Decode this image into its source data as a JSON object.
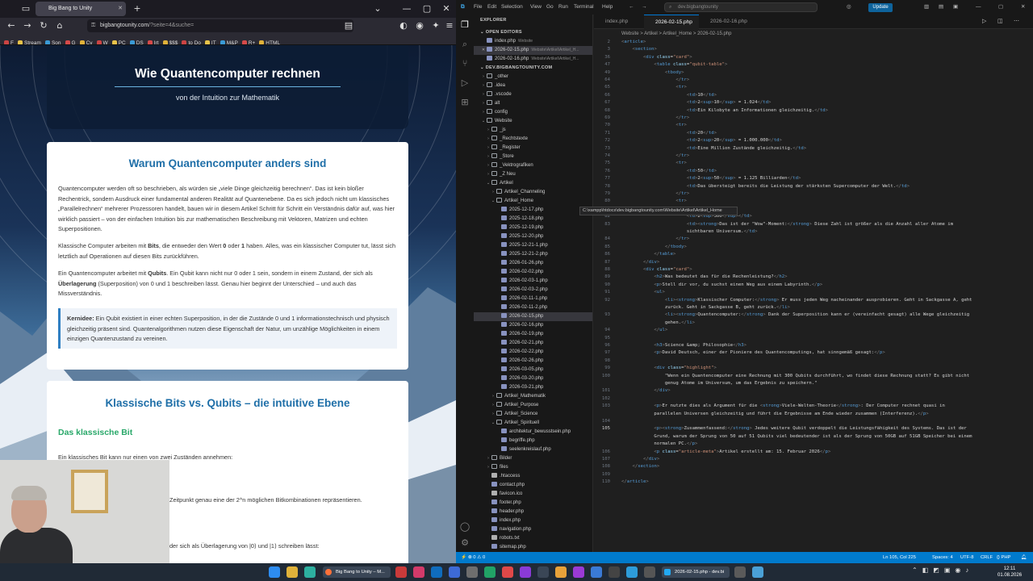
{
  "browser": {
    "tab_title": "Big Bang to Unity",
    "url_domain": "bigbangtounity.com",
    "url_path": "/?seite=4&suche=",
    "bookmarks": [
      "F",
      "Stream",
      "Son",
      "G",
      "Cy",
      "W",
      "PC",
      "DS",
      "Irt",
      "$$$",
      "to Do",
      "IT",
      "M&P",
      "R+",
      "HTML"
    ],
    "page": {
      "hero_title": "Wie Quantencomputer rechnen",
      "hero_subtitle": "von der Intuition zur Mathematik",
      "card1": {
        "heading": "Warum Quantencomputer anders sind",
        "p1": "Quantencomputer werden oft so beschrieben, als würden sie „viele Dinge gleichzeitig berechnen“. Das ist kein bloßer Rechentrick, sondern Ausdruck einer fundamental anderen Realität auf Quantenebene. Da es sich jedoch nicht um klassisches „Parallelrechnen“ mehrerer Prozessoren handelt, bauen wir in diesem Artikel Schritt für Schritt ein Verständnis dafür auf, was hier wirklich passiert – von der einfachen Intuition bis zur mathematischen Beschreibung mit Vektoren, Matrizen und echten Superpositionen.",
        "p2_a": "Klassische Computer arbeiten mit ",
        "p2_b": "Bits",
        "p2_c": ", die entweder den Wert ",
        "p2_d": "0",
        "p2_e": " oder ",
        "p2_f": "1",
        "p2_g": " haben. Alles, was ein klassischer Computer tut, lässt sich letztlich auf Operationen auf diesen Bits zurückführen.",
        "p3_a": "Ein Quantencomputer arbeitet mit ",
        "p3_b": "Qubits",
        "p3_c": ". Ein Qubit kann nicht nur 0 oder 1 sein, sondern in einem Zustand, der sich als ",
        "p3_d": "Überlagerung",
        "p3_e": " (Superposition) von 0 und 1 beschreiben lässt. Genau hier beginnt der Unterschied – und auch das Missverständnis.",
        "kern_label": "Kernidee:",
        "kern_text": " Ein Qubit existiert in einer echten Superposition, in der die Zustände 0 und 1 informationstechnisch und physisch gleichzeitig präsent sind. Quantenalgorithmen nutzen diese Eigenschaft der Natur, um unzählige Möglichkeiten in einem einzigen Quantenzustand zu vereinen."
      },
      "card2": {
        "heading": "Klassische Bits vs. Qubits – die intuitive Ebene",
        "subheading": "Das klassische Bit",
        "p1": "Ein klassisches Bit kann nur einen von zwei Zuständen annehmen:",
        "p2_partial": "Zeitpunkt genau eine der 2^n möglichen Bitkombinationen repräsentieren.",
        "p3_partial": "der sich als Überlagerung von |0⟩ und |1⟩ schreiben lässt:"
      }
    }
  },
  "vscode": {
    "menu": [
      "File",
      "Edit",
      "Selection",
      "View",
      "Go",
      "Run",
      "Terminal",
      "Help"
    ],
    "search": "dev.bigbangtounity",
    "update_label": "Update",
    "explorer_title": "EXPLORER",
    "open_editors_title": "OPEN EDITORS",
    "open_editors": [
      {
        "name": "index.php",
        "hint": "Website"
      },
      {
        "name": "2026-02-15.php",
        "hint": "Website\\Artikel\\Artikel_H..."
      },
      {
        "name": "2026-02-16.php",
        "hint": "Website\\Artikel\\Artikel_H..."
      }
    ],
    "workspace_title": "DEV.BIGBANGTOUNITY.COM",
    "tree": [
      {
        "d": 1,
        "t": "f",
        "n": "_other"
      },
      {
        "d": 1,
        "t": "f",
        "n": ".idea"
      },
      {
        "d": 1,
        "t": "f",
        "n": ".vscode"
      },
      {
        "d": 1,
        "t": "f",
        "n": "alt"
      },
      {
        "d": 1,
        "t": "f",
        "n": "config"
      },
      {
        "d": 1,
        "t": "o",
        "n": "Website"
      },
      {
        "d": 2,
        "t": "f",
        "n": "_js"
      },
      {
        "d": 2,
        "t": "f",
        "n": "_Rechtstexte"
      },
      {
        "d": 2,
        "t": "f",
        "n": "_Register"
      },
      {
        "d": 2,
        "t": "f",
        "n": "_Store"
      },
      {
        "d": 2,
        "t": "f",
        "n": "_Vektrografiken"
      },
      {
        "d": 2,
        "t": "f",
        "n": "_Z Neu"
      },
      {
        "d": 2,
        "t": "o",
        "n": "Artikel"
      },
      {
        "d": 3,
        "t": "f",
        "n": "Artikel_Channeling"
      },
      {
        "d": 3,
        "t": "o",
        "n": "Artikel_Home"
      },
      {
        "d": 4,
        "t": "p",
        "n": "2025-12-17.php"
      },
      {
        "d": 4,
        "t": "p",
        "n": "2025-12-18.php"
      },
      {
        "d": 4,
        "t": "p",
        "n": "2025-12-19.php"
      },
      {
        "d": 4,
        "t": "p",
        "n": "2025-12-20.php"
      },
      {
        "d": 4,
        "t": "p",
        "n": "2025-12-21-1.php"
      },
      {
        "d": 4,
        "t": "p",
        "n": "2025-12-21-2.php"
      },
      {
        "d": 4,
        "t": "p",
        "n": "2026-01-26.php"
      },
      {
        "d": 4,
        "t": "p",
        "n": "2026-02-02.php"
      },
      {
        "d": 4,
        "t": "p",
        "n": "2026-02-03-1.php"
      },
      {
        "d": 4,
        "t": "p",
        "n": "2026-02-03-2.php"
      },
      {
        "d": 4,
        "t": "p",
        "n": "2026-02-11-1.php"
      },
      {
        "d": 4,
        "t": "p",
        "n": "2026-02-11-2.php"
      },
      {
        "d": 4,
        "t": "p",
        "n": "2026-02-15.php",
        "sel": true
      },
      {
        "d": 4,
        "t": "p",
        "n": "2026-02-16.php"
      },
      {
        "d": 4,
        "t": "p",
        "n": "2026-02-19.php"
      },
      {
        "d": 4,
        "t": "p",
        "n": "2026-02-21.php"
      },
      {
        "d": 4,
        "t": "p",
        "n": "2026-02-22.php"
      },
      {
        "d": 4,
        "t": "p",
        "n": "2026-02-26.php"
      },
      {
        "d": 4,
        "t": "p",
        "n": "2026-03-05.php"
      },
      {
        "d": 4,
        "t": "p",
        "n": "2026-03-20.php"
      },
      {
        "d": 4,
        "t": "p",
        "n": "2026-03-21.php"
      },
      {
        "d": 3,
        "t": "f",
        "n": "Artikel_Mathematik"
      },
      {
        "d": 3,
        "t": "f",
        "n": "Artikel_Purpose"
      },
      {
        "d": 3,
        "t": "f",
        "n": "Artikel_Science"
      },
      {
        "d": 3,
        "t": "o",
        "n": "Artikel_Spirituell"
      },
      {
        "d": 4,
        "t": "p",
        "n": "architektur_bewusstsein.php"
      },
      {
        "d": 4,
        "t": "p",
        "n": "begriffe.php"
      },
      {
        "d": 4,
        "t": "p",
        "n": "seelenkreislauf.php"
      },
      {
        "d": 2,
        "t": "f",
        "n": "Bilder"
      },
      {
        "d": 2,
        "t": "f",
        "n": "files"
      },
      {
        "d": 2,
        "t": "x",
        "n": ".htaccess"
      },
      {
        "d": 2,
        "t": "p",
        "n": "contact.php"
      },
      {
        "d": 2,
        "t": "x",
        "n": "favicon.ico"
      },
      {
        "d": 2,
        "t": "p",
        "n": "footer.php"
      },
      {
        "d": 2,
        "t": "p",
        "n": "header.php"
      },
      {
        "d": 2,
        "t": "p",
        "n": "index.php"
      },
      {
        "d": 2,
        "t": "p",
        "n": "navigation.php"
      },
      {
        "d": 2,
        "t": "x",
        "n": "robots.txt"
      },
      {
        "d": 2,
        "t": "p",
        "n": "sitemap.php"
      }
    ],
    "tooltip": "C:\\xampp\\htdocs\\dev.bigbangtounity.com\\Website\\Artikel\\Artikel_Home",
    "tabs": [
      "index.php",
      "2026-02-15.php",
      "2026-02-16.php"
    ],
    "breadcrumb": "Website  >  Artikel  >  Artikel_Home  >  2026-02-15.php",
    "code": [
      [
        "2",
        "<article>"
      ],
      [
        "3",
        "    <section>"
      ],
      [
        "36",
        "        <div class=\"card\">"
      ],
      [
        "47",
        "            <table class=\"qubit-table\">"
      ],
      [
        "49",
        "                <tbody>"
      ],
      [
        "64",
        "                    </tr>"
      ],
      [
        "65",
        "                    <tr>"
      ],
      [
        "66",
        "                        <td>10</td>"
      ],
      [
        "67",
        "                        <td>2<sup>10</sup> = 1.024</td>"
      ],
      [
        "68",
        "                        <td>Ein Kilobyte an Informationen gleichzeitig.</td>"
      ],
      [
        "69",
        "                    </tr>"
      ],
      [
        "70",
        "                    <tr>"
      ],
      [
        "71",
        "                        <td>20</td>"
      ],
      [
        "72",
        "                        <td>2<sup>20</sup> = 1.000.000</td>"
      ],
      [
        "73",
        "                        <td>Eine Million Zustände gleichzeitig.</td>"
      ],
      [
        "74",
        "                    </tr>"
      ],
      [
        "75",
        "                    <tr>"
      ],
      [
        "76",
        "                        <td>50</td>"
      ],
      [
        "77",
        "                        <td>2<sup>50</sup> = 1.125 Billiarden</td>"
      ],
      [
        "78",
        "                        <td>Das übersteigt bereits die Leistung der stärksten Supercomputer der Welt.</td>"
      ],
      [
        "79",
        "                    </tr>"
      ],
      [
        "80",
        "                    <tr>"
      ],
      [
        "81",
        ""
      ],
      [
        "82",
        "                        <td>2<sup>300</sup></td>"
      ],
      [
        "83",
        "                        <td><strong>Das ist der \"Wow\"-Moment:</strong> Diese Zahl ist größer als die Anzahl aller Atome im"
      ],
      [
        "",
        "                        sichtbaren Universum.</td>"
      ],
      [
        "84",
        "                    </tr>"
      ],
      [
        "85",
        "                </tbody>"
      ],
      [
        "86",
        "            </table>"
      ],
      [
        "87",
        "        </div>"
      ],
      [
        "88",
        "        <div class=\"card\">"
      ],
      [
        "89",
        "            <h2>Was bedeutet das für die Rechenleistung?</h2>"
      ],
      [
        "90",
        "            <p>Stell dir vor, du suchst einen Weg aus einem Labyrinth.</p>"
      ],
      [
        "91",
        "            <ul>"
      ],
      [
        "92",
        "                <li><strong>Klassischer Computer:</strong> Er muss jeden Weg nacheinander ausprobieren. Geht in Sackgasse A, geht"
      ],
      [
        "",
        "                zurück. Geht in Sackgasse B, geht zurück.</li>"
      ],
      [
        "93",
        "                <li><strong>Quantencomputer:</strong> Dank der Superposition kann er (vereinfacht gesagt) alle Wege gleichzeitig"
      ],
      [
        "",
        "                gehen.</li>"
      ],
      [
        "94",
        "            </ul>"
      ],
      [
        "95",
        ""
      ],
      [
        "96",
        "            <h3>Science &amp; Philosophie</h3>"
      ],
      [
        "97",
        "            <p>David Deutsch, einer der Pioniere des Quantencomputings, hat sinngemäß gesagt:</p>"
      ],
      [
        "98",
        ""
      ],
      [
        "99",
        "            <div class=\"highlight\">"
      ],
      [
        "100",
        "                \"Wenn ein Quantencomputer eine Rechnung mit 300 Qubits durchführt, wo findet diese Rechnung statt? Es gibt nicht"
      ],
      [
        "",
        "                genug Atome im Universum, um das Ergebnis zu speichern.\""
      ],
      [
        "101",
        "            </div>"
      ],
      [
        "102",
        ""
      ],
      [
        "103",
        "            <p>Er nutzte dies als Argument für die <strong>Viele-Welten-Theorie</strong>: Der Computer rechnet quasi in"
      ],
      [
        "",
        "            parallelen Universen gleichzeitig und führt die Ergebnisse am Ende wieder zusammen (Interferenz).</p>"
      ],
      [
        "104",
        ""
      ],
      [
        "105",
        "            <p><strong>Zusammenfassend:</strong> Jedes weitere Qubit verdoppelt die Leistungsfähigkeit des Systems. Das ist der"
      ],
      [
        "",
        "            Grund, warum der Sprung von 50 auf 51 Qubits viel bedeutender ist als der Sprung von 50GB auf 51GB Speicher bei einem"
      ],
      [
        "",
        "            normalen PC.</p>"
      ],
      [
        "106",
        "            <p class=\"article-meta\">Artikel erstellt am: 15. Februar 2026</p>"
      ],
      [
        "107",
        "        </div>"
      ],
      [
        "108",
        "    </section>"
      ],
      [
        "109",
        ""
      ],
      [
        "110",
        "</article>"
      ]
    ],
    "status": {
      "left": "⚡  ⊗ 0 ⚠ 0",
      "position": "Ln 105, Col 225",
      "spaces": "Spaces: 4",
      "encoding": "UTF-8",
      "eol": "CRLF",
      "lang": "{} PHP"
    }
  },
  "taskbar": {
    "active_app": "Big Bang to Unity – M...",
    "vscode_app": "2026-02-15.php - dev.bi",
    "time": "12:11",
    "date": "01.08.2026"
  }
}
